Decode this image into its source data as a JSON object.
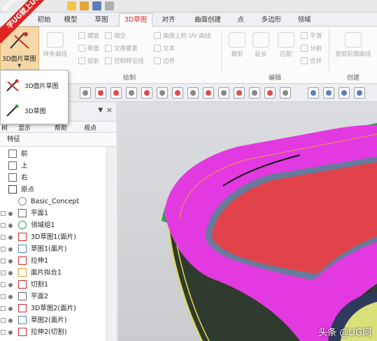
{
  "watermark": {
    "top": "9SUG",
    "main": "学UG就上UG网"
  },
  "tabs": [
    {
      "label": "初始",
      "active": false
    },
    {
      "label": "模型",
      "active": false
    },
    {
      "label": "草图",
      "active": false
    },
    {
      "label": "3D草图",
      "active": true
    },
    {
      "label": "对齐",
      "active": false
    },
    {
      "label": "曲面创建",
      "active": false
    },
    {
      "label": "点",
      "active": false
    },
    {
      "label": "多边形",
      "active": false
    },
    {
      "label": "领域",
      "active": false
    }
  ],
  "ribbon": {
    "big_button": "3D面片草图",
    "draw_items": [
      "样条曲线",
      "螺旋",
      "断面",
      "相交",
      "椭圆",
      "交换要素",
      "投影",
      "控制特征线",
      "曲面上的 UV 曲线",
      "文本",
      "边界"
    ],
    "edit_items": [
      "裁剪",
      "延长",
      "匹配",
      "平滑",
      "分割",
      "合并"
    ],
    "create_items": [
      "提取轮廓曲线"
    ],
    "groups": [
      "绘制",
      "编辑",
      "创建"
    ]
  },
  "dropdown": {
    "items": [
      "3D面片草图",
      "3D草图"
    ]
  },
  "panel": {
    "tabs": [
      "树",
      "显示",
      "帮助",
      "视点"
    ],
    "header": "特征",
    "tree": [
      {
        "label": "前",
        "icon": "plane"
      },
      {
        "label": "上",
        "icon": "plane"
      },
      {
        "label": "右",
        "icon": "plane"
      },
      {
        "label": "原点",
        "icon": "origin"
      },
      {
        "label": "Basic_Concept",
        "icon": "circle"
      },
      {
        "label": "平面1",
        "icon": "plane"
      },
      {
        "label": "领域组1",
        "icon": "region"
      },
      {
        "label": "3D草图1(面片)",
        "icon": "sketch3d"
      },
      {
        "label": "草图1(面片)",
        "icon": "sketch"
      },
      {
        "label": "拉伸1",
        "icon": "extrude"
      },
      {
        "label": "面片拟合1",
        "icon": "fit"
      },
      {
        "label": "切割1",
        "icon": "cut"
      },
      {
        "label": "平面2",
        "icon": "plane"
      },
      {
        "label": "3D草图2(面片)",
        "icon": "sketch3d"
      },
      {
        "label": "草图2(面片)",
        "icon": "sketch"
      },
      {
        "label": "拉伸2(切割)",
        "icon": "extrude"
      }
    ]
  },
  "viewport": {
    "credit": "头条 @UG网"
  },
  "colors": {
    "accent": "#d02a2a",
    "magenta": "#e23ae0",
    "red_face": "#e0444a",
    "green_edge": "#2ea24a",
    "yellow_edge": "#e6d84a"
  }
}
